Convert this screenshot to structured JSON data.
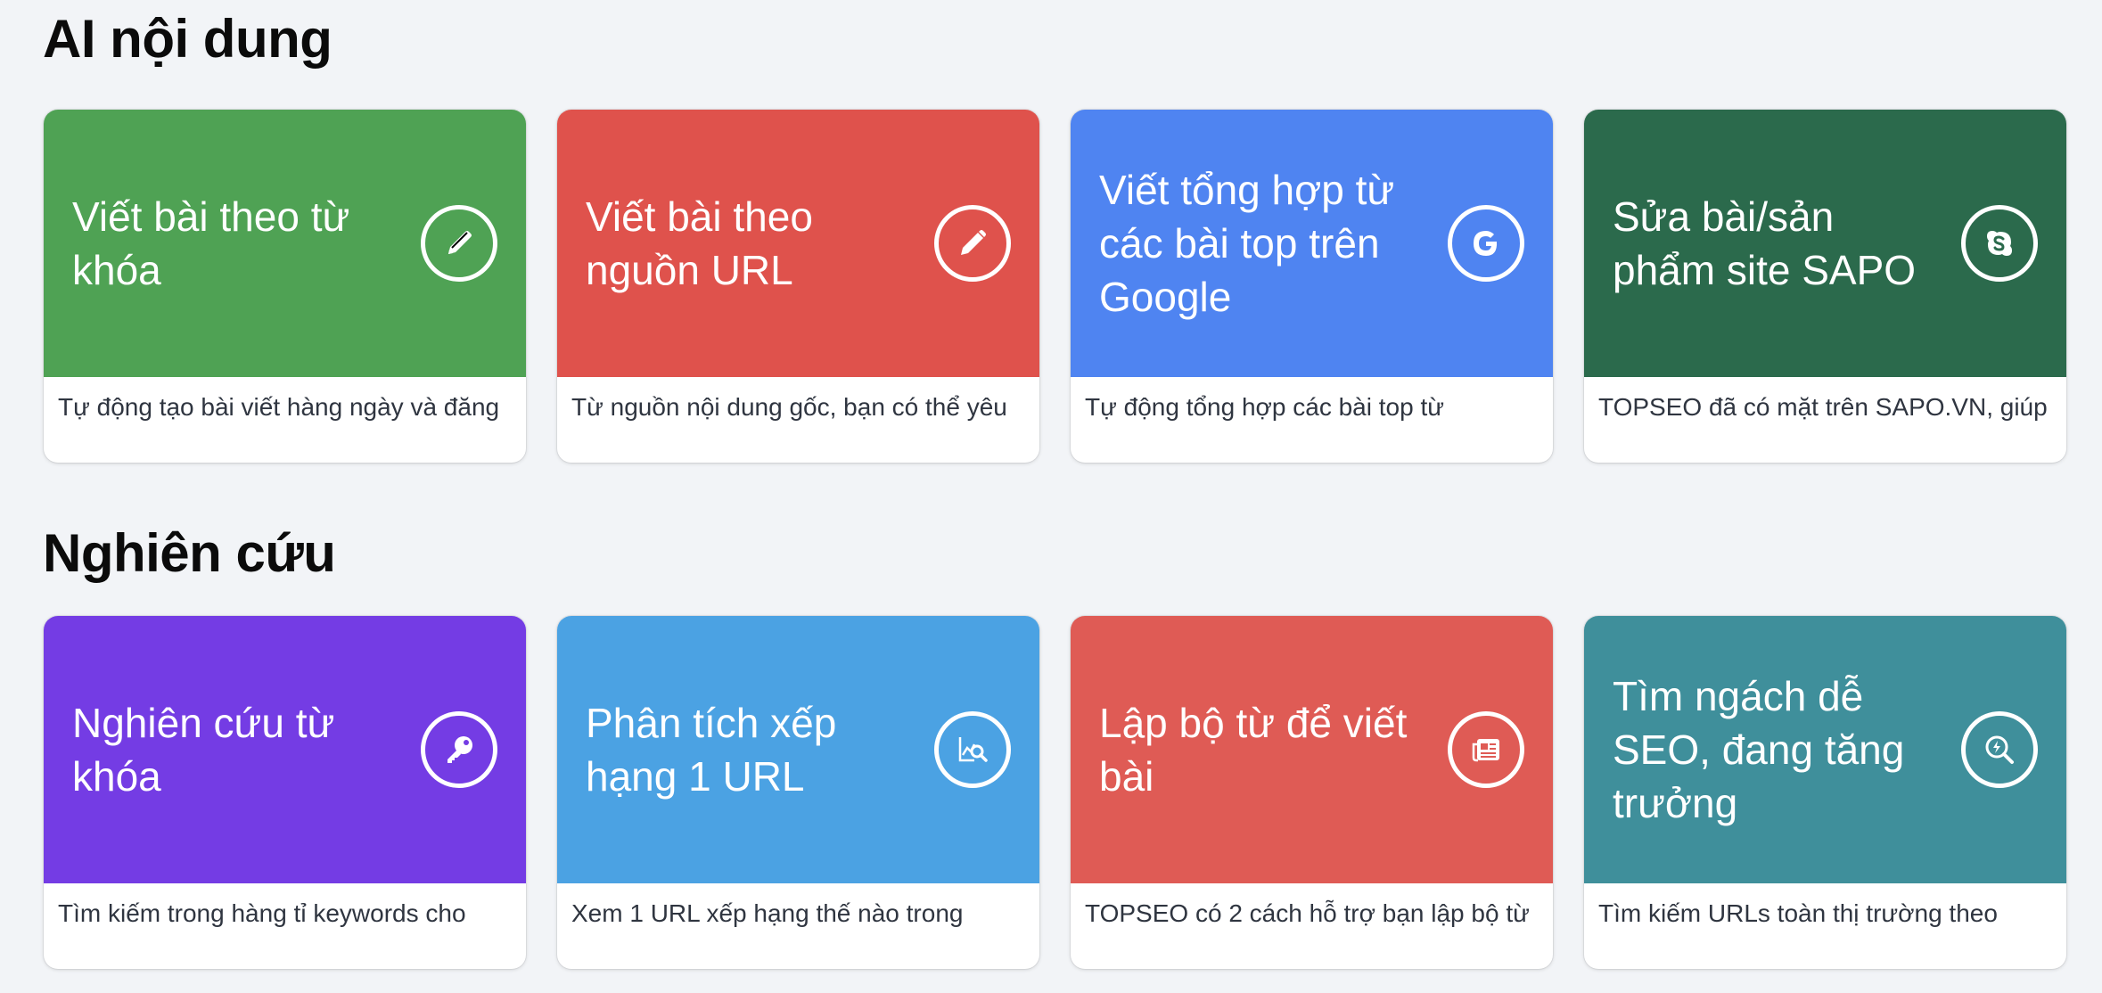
{
  "sections": [
    {
      "title": "AI nội dung",
      "cards": [
        {
          "title": "Viết bài theo từ khóa",
          "desc": "Tự động tạo bài viết hàng ngày và đăng",
          "icon": "pencil-icon",
          "color": "#4fa254"
        },
        {
          "title": "Viết bài theo nguồn URL",
          "desc": "Từ nguồn nội dung gốc, bạn có thể yêu",
          "icon": "pencil-icon",
          "color": "#df524c"
        },
        {
          "title": "Viết tổng hợp từ các bài top trên Google",
          "desc": "Tự động tổng hợp các bài top từ",
          "icon": "google-icon",
          "color": "#4f84f1"
        },
        {
          "title": "Sửa bài/sản phẩm site SAPO",
          "desc": "TOPSEO đã có mặt trên SAPO.VN, giúp",
          "icon": "sapo-icon",
          "color": "#2b6a4c"
        }
      ]
    },
    {
      "title": "Nghiên cứu",
      "cards": [
        {
          "title": "Nghiên cứu từ khóa",
          "desc": "Tìm kiếm trong hàng tỉ keywords cho",
          "icon": "key-icon",
          "color": "#743ce4"
        },
        {
          "title": "Phân tích xếp hạng 1 URL",
          "desc": "Xem 1 URL xếp hạng thế nào trong",
          "icon": "chart-search-icon",
          "color": "#4ba2e3"
        },
        {
          "title": "Lập bộ từ để viết bài",
          "desc": "TOPSEO có 2 cách hỗ trợ bạn lập bộ từ",
          "icon": "newspaper-icon",
          "color": "#df5b55"
        },
        {
          "title": "Tìm ngách dễ SEO, đang tăng trưởng",
          "desc": "Tìm kiếm URLs toàn thị trường theo",
          "icon": "search-lightning-icon",
          "color": "#3f8f9b"
        }
      ]
    }
  ]
}
